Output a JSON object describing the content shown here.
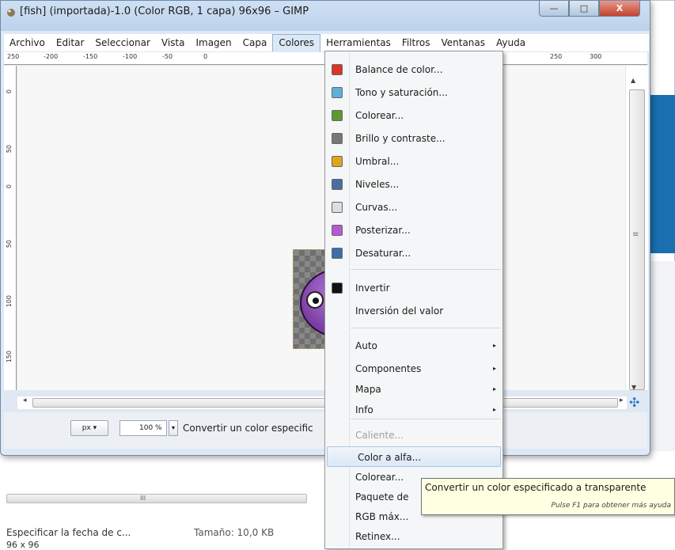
{
  "window": {
    "title": "[fish] (importada)-1.0 (Color RGB, 1 capa) 96x96 – GIMP",
    "controls": {
      "minimize": "—",
      "maximize": "□",
      "close": "X"
    }
  },
  "menubar": [
    "Archivo",
    "Editar",
    "Seleccionar",
    "Vista",
    "Imagen",
    "Capa",
    "Colores",
    "Herramientas",
    "Filtros",
    "Ventanas",
    "Ayuda"
  ],
  "ruler_top": [
    "250",
    "-200",
    "-150",
    "-100",
    "-50",
    "0",
    "250",
    "300"
  ],
  "ruler_left": [
    "0",
    "50",
    "0",
    "50",
    "100",
    "150"
  ],
  "statusbar": {
    "unit": "px ▾",
    "zoom": "100 %",
    "zoom_arrow": "▾",
    "message": "Convertir un color especific"
  },
  "menu_colores": {
    "items": [
      {
        "label": "Balance de color...",
        "icon": "color-balance-icon",
        "color": "#d9362b"
      },
      {
        "label": "Tono y saturación...",
        "icon": "hue-saturation-icon",
        "color": "#5fb0d8"
      },
      {
        "label": "Colorear...",
        "icon": "colorize-icon",
        "color": "#5a9a2f"
      },
      {
        "label": "Brillo y contraste...",
        "icon": "brightness-contrast-icon",
        "color": "#777777"
      },
      {
        "label": "Umbral...",
        "icon": "threshold-icon",
        "color": "#e0a51b"
      },
      {
        "label": "Niveles...",
        "icon": "levels-icon",
        "color": "#4a6ea0"
      },
      {
        "label": "Curvas...",
        "icon": "curves-icon",
        "color": "#dddddd"
      },
      {
        "label": "Posterizar...",
        "icon": "posterize-icon",
        "color": "#b75ad1"
      },
      {
        "label": "Desaturar...",
        "icon": "desaturate-icon",
        "color": "#3a6fa8"
      },
      {
        "label": "Invertir",
        "icon": "invert-icon",
        "color": "#111111"
      },
      {
        "label": "Inversión del valor",
        "icon": "",
        "color": ""
      },
      {
        "label": "Auto",
        "submenu": true
      },
      {
        "label": "Componentes",
        "submenu": true
      },
      {
        "label": "Mapa",
        "submenu": true
      },
      {
        "label": "Info",
        "submenu": true
      },
      {
        "label": "Caliente...",
        "disabled": true
      },
      {
        "label": "Color a alfa...",
        "highlighted": true
      },
      {
        "label": "Colorear..."
      },
      {
        "label": "Paquete de"
      },
      {
        "label": "RGB máx..."
      },
      {
        "label": "Retinex..."
      }
    ],
    "submenu_arrow": "▸"
  },
  "tooltip": {
    "text": "Convertir un color especificado a transparente",
    "help": "Pulse F1 para obtener más ayuda"
  },
  "background": {
    "description": "Especificar la fecha de c...",
    "size": "Tamaño: 10,0 KB",
    "dims": "96 x 96",
    "scroll_mark": "III"
  },
  "scroll": {
    "up": "▲",
    "down": "▼",
    "left": "◂",
    "right": "▸",
    "grip": "≡",
    "nav": "✣"
  }
}
